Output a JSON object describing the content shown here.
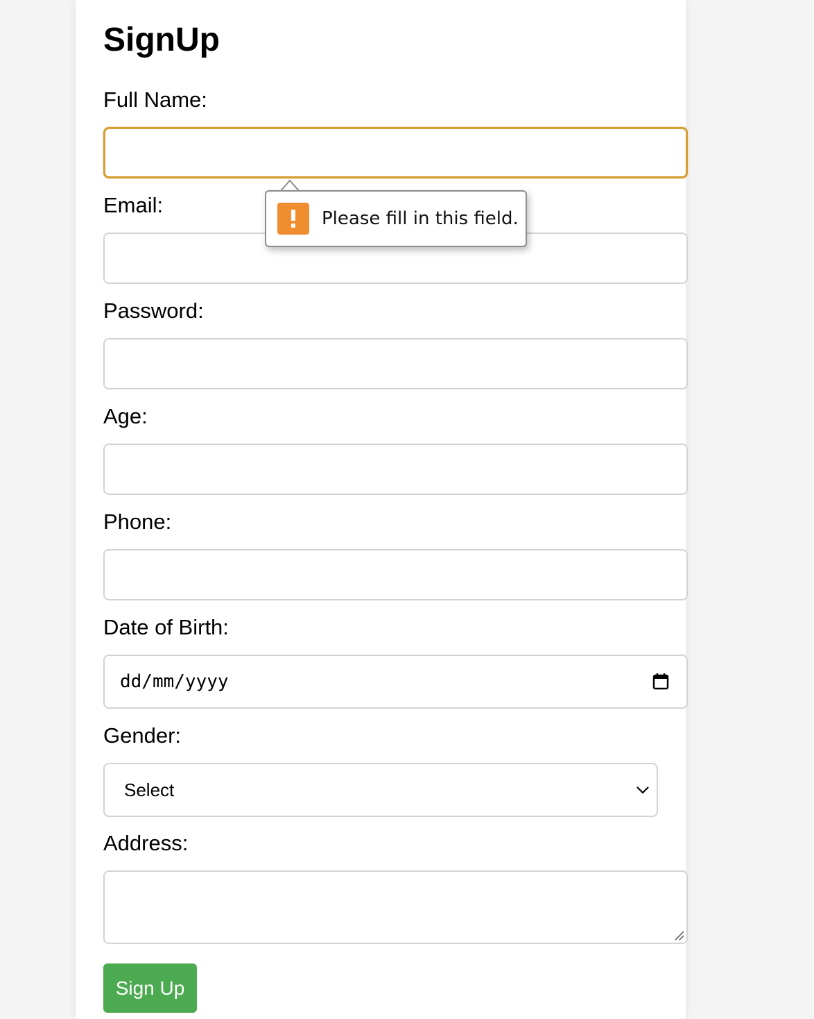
{
  "form": {
    "title": "SignUp",
    "fields": {
      "full_name": {
        "label": "Full Name:",
        "value": ""
      },
      "email": {
        "label": "Email:",
        "value": ""
      },
      "password": {
        "label": "Password:",
        "value": ""
      },
      "age": {
        "label": "Age:",
        "value": ""
      },
      "phone": {
        "label": "Phone:",
        "value": ""
      },
      "dob": {
        "label": "Date of Birth:",
        "placeholder": "dd/mm/yyyy"
      },
      "gender": {
        "label": "Gender:",
        "selected": "Select"
      },
      "address": {
        "label": "Address:",
        "value": ""
      }
    },
    "submit_label": "Sign Up"
  },
  "validation": {
    "message": "Please fill in this field.",
    "icon": "warning-icon"
  },
  "icons": {
    "date_picker": "calendar-icon",
    "select": "chevron-down-icon",
    "textarea": "resize-handle-icon"
  },
  "colors": {
    "focus_border": "#d69d32",
    "warning": "#f08d2f",
    "submit_button": "#4caa50",
    "background": "#f4f4f4"
  }
}
